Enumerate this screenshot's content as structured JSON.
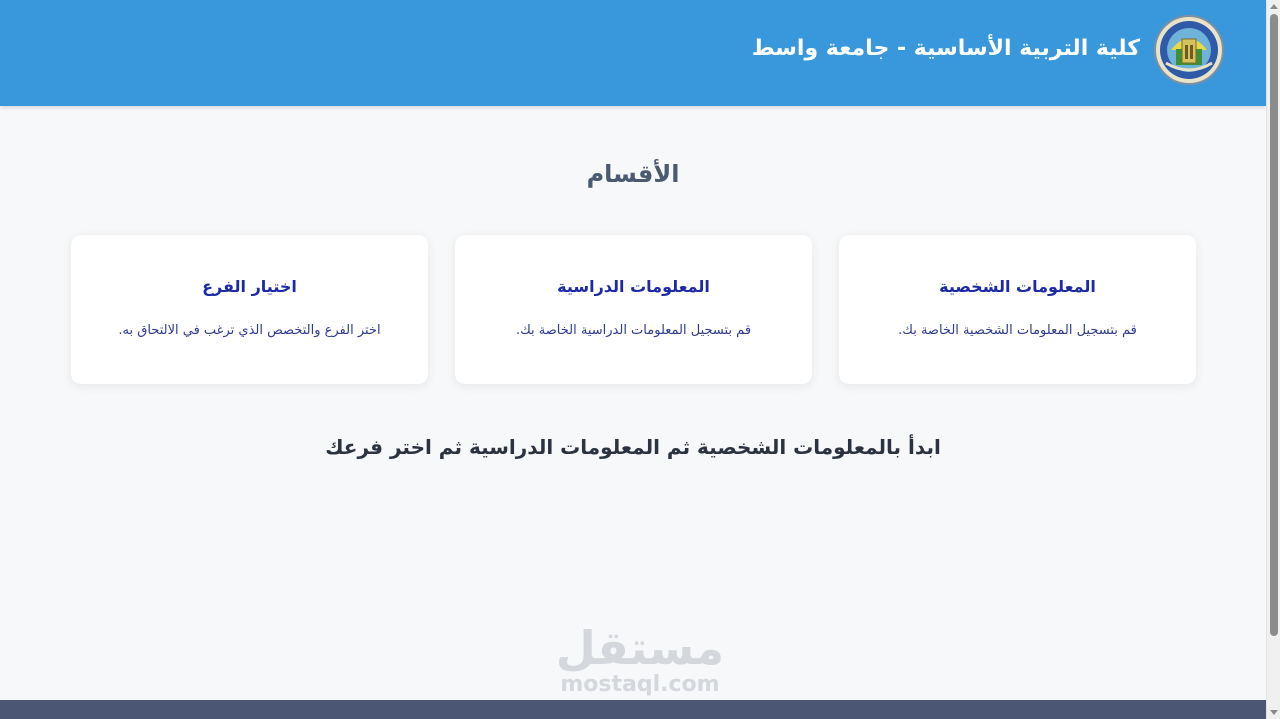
{
  "header": {
    "title": "كلية التربية الأساسية - جامعة واسط",
    "logo_icon": "college-seal-logo",
    "background_color": "#3898db"
  },
  "main": {
    "section_title": "الأقسام",
    "cards": [
      {
        "title": "المعلومات الشخصية",
        "description": "قم بتسجيل المعلومات الشخصية الخاصة بك."
      },
      {
        "title": "المعلومات الدراسية",
        "description": "قم بتسجيل المعلومات الدراسية الخاصة بك."
      },
      {
        "title": "اختيار الفرع",
        "description": "اختر الفرع والتخصص الذي ترغب في الالتحاق به."
      }
    ],
    "instruction": "ابدأ بالمعلومات الشخصية ثم المعلومات الدراسية ثم اختر فرعك"
  },
  "watermark": {
    "arabic": "مستقل",
    "latin": "mostaql.com"
  },
  "colors": {
    "card_title": "#1c2aa8",
    "footer": "#4a5673",
    "page_background": "#f6f8fa"
  }
}
